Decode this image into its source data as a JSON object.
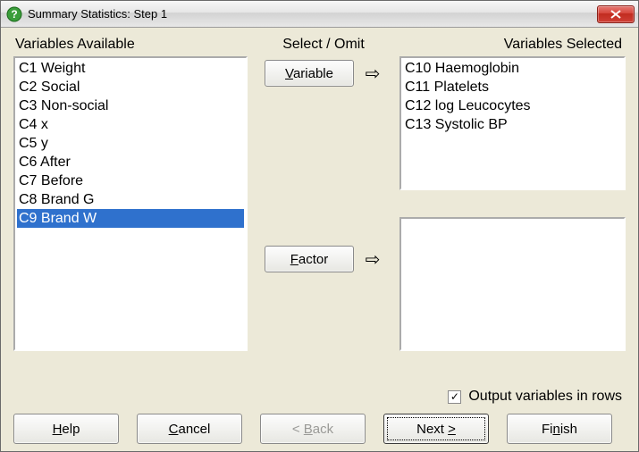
{
  "titlebar": {
    "title": "Summary Statistics: Step 1"
  },
  "labels": {
    "available": "Variables Available",
    "select_omit": "Select / Omit",
    "selected": "Variables Selected"
  },
  "buttons": {
    "variable_pre": "V",
    "variable_post": "ariable",
    "factor_pre": "F",
    "factor_post": "actor"
  },
  "available": [
    "C1 Weight",
    "C2 Social",
    "C3 Non-social",
    "C4 x",
    "C5 y",
    "C6 After",
    "C7 Before",
    "C8 Brand G",
    "C9 Brand W"
  ],
  "available_selected_index": 8,
  "selected_vars": [
    "C10 Haemoglobin",
    "C11 Platelets",
    "C12 log Leucocytes",
    "C13 Systolic BP"
  ],
  "selected_factors": [],
  "checkbox": {
    "label": "Output variables in rows",
    "checked": true,
    "mark": "✓"
  },
  "footer": {
    "help_pre": "H",
    "help_post": "elp",
    "cancel_pre": "C",
    "cancel_post": "ancel",
    "back_pre": "< ",
    "back_u": "B",
    "back_post": "ack",
    "next_pre": "Next ",
    "next_u": ">",
    "next_post": "",
    "finish_pre": "Fi",
    "finish_u": "n",
    "finish_post": "ish"
  }
}
